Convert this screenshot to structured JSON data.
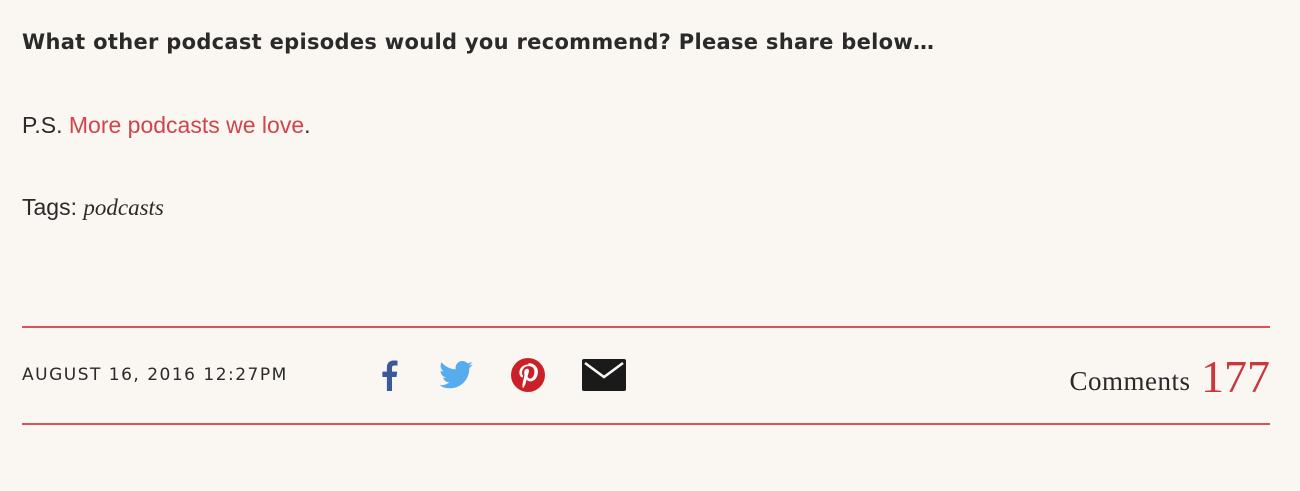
{
  "post": {
    "question": "What other podcast episodes would you recommend? Please share below…",
    "ps_prefix": "P.S. ",
    "ps_link": "More podcasts we love",
    "ps_suffix": ".",
    "tags_label": "Tags: ",
    "tag": "podcasts"
  },
  "footer": {
    "date": "AUGUST 16, 2016 12:27PM",
    "share_icons": [
      "facebook-icon",
      "twitter-icon",
      "pinterest-icon",
      "email-icon"
    ],
    "comments_label": "Comments",
    "comments_count": "177"
  },
  "colors": {
    "background": "#faf6f2",
    "accent_red": "#d0454a",
    "rule": "#d9545a",
    "facebook": "#3b5998",
    "twitter": "#55acee",
    "pinterest": "#cb2027",
    "email": "#1a1a1a"
  }
}
